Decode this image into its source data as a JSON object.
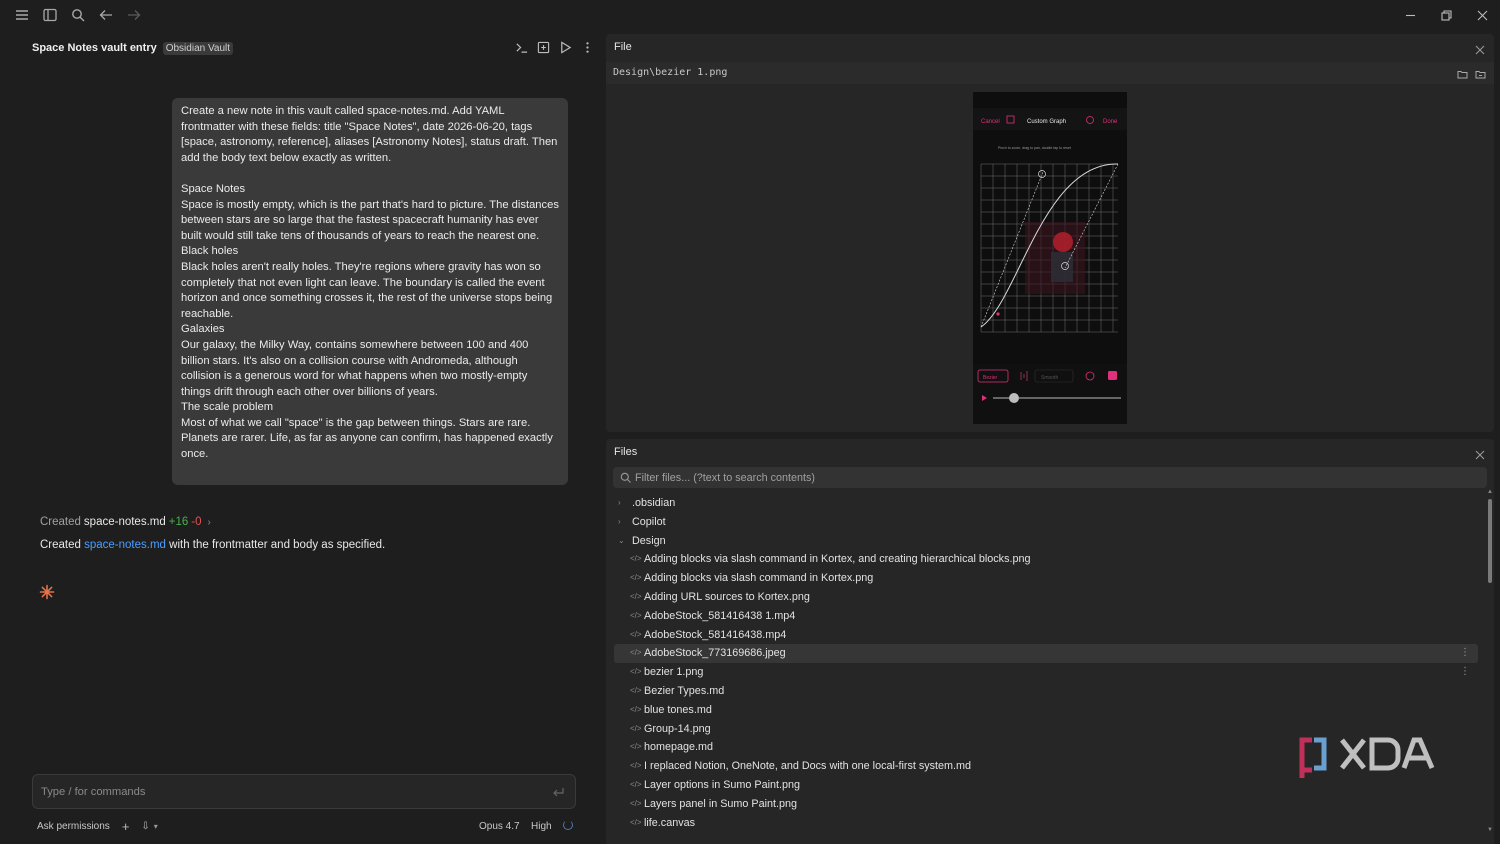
{
  "chat": {
    "title": "Space Notes vault entry",
    "badge": "Obsidian Vault",
    "message": "Create a new note in this vault called space-notes.md. Add YAML frontmatter with these fields: title \"Space Notes\", date 2026-06-20, tags [space, astronomy, reference], aliases [Astronomy Notes], status draft. Then add the body text below exactly as written.\n\nSpace Notes\nSpace is mostly empty, which is the part that's hard to picture. The distances between stars are so large that the fastest spacecraft humanity has ever built would still take tens of thousands of years to reach the nearest one.\nBlack holes\nBlack holes aren't really holes. They're regions where gravity has won so completely that not even light can leave. The boundary is called the event horizon and once something crosses it, the rest of the universe stops being reachable.\nGalaxies\nOur galaxy, the Milky Way, contains somewhere between 100 and 400 billion stars. It's also on a collision course with Andromeda, although collision is a generous word for what happens when two mostly-empty things drift through each other over billions of years.\nThe scale problem\nMost of what we call \"space\" is the gap between things. Stars are rare. Planets are rarer. Life, as far as anyone can confirm, has happened exactly once.",
    "created_prefix": "Created",
    "created_file": "space-notes.md",
    "created_plus": "+16",
    "created_minus": "-0",
    "result_prefix": "Created",
    "result_link": "space-notes.md",
    "result_suffix": "with the frontmatter and body as specified.",
    "input_placeholder": "Type / for commands",
    "permissions": "Ask permissions",
    "model": "Opus 4.7",
    "effort": "High"
  },
  "file_pane": {
    "title": "File",
    "path": "Design\\bezier 1.png",
    "preview": {
      "cancel": "Cancel",
      "title": "Custom Graph",
      "done": "Done",
      "hint": "Pinch to zoom, drag to pan, double tap to reset",
      "mode": "Bezier",
      "mode2": "Smooth"
    }
  },
  "files_pane": {
    "title": "Files",
    "filter_placeholder": "Filter files... (?text to search contents)",
    "folders": [
      ".obsidian",
      "Copilot",
      "Design"
    ],
    "files": [
      "Adding blocks via slash command in Kortex, and creating hierarchical blocks.png",
      "Adding blocks via slash command in Kortex.png",
      "Adding URL sources to Kortex.png",
      "AdobeStock_581416438 1.mp4",
      "AdobeStock_581416438.mp4",
      "AdobeStock_773169686.jpeg",
      "bezier 1.png",
      "Bezier Types.md",
      "blue tones.md",
      "Group-14.png",
      "homepage.md",
      "I replaced Notion, OneNote, and Docs with one local-first system.md",
      "Layer options in Sumo Paint.png",
      "Layers panel in Sumo Paint.png",
      "life.canvas"
    ],
    "selected_index": 5
  },
  "watermark": "XDA",
  "colors": {
    "accent_link": "#4a9eff",
    "added": "#4caf50",
    "removed": "#e05353",
    "spark": "#e2734b",
    "preview_pink": "#e0307a"
  }
}
